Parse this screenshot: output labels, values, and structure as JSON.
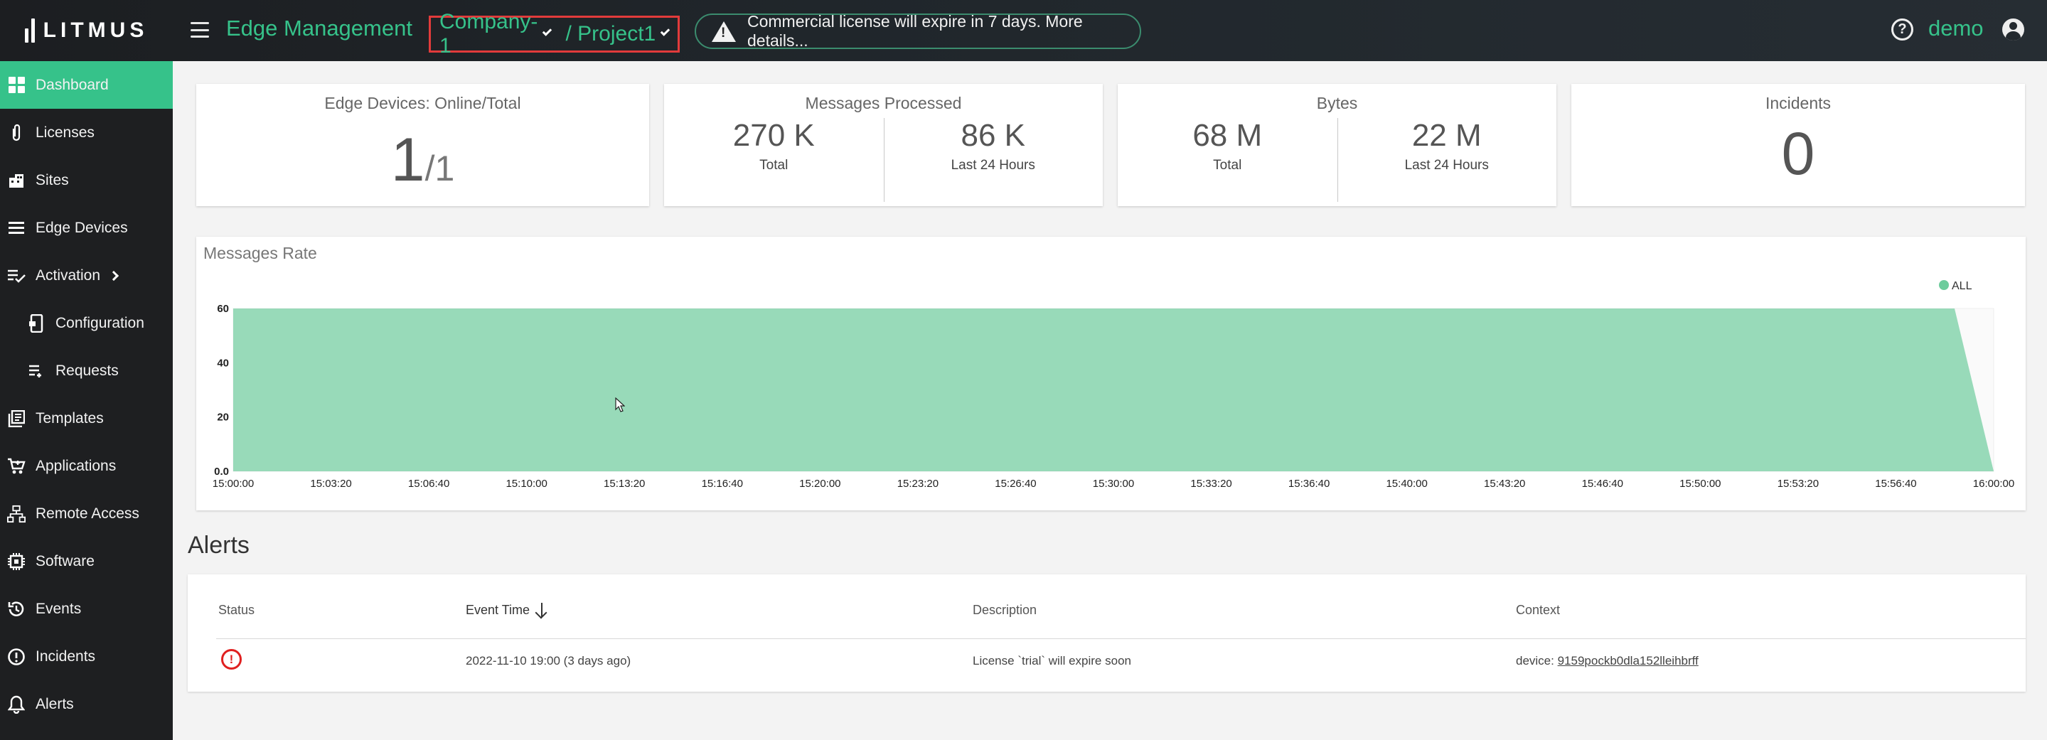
{
  "header": {
    "logo_text": "LITMUS",
    "app_title": "Edge Management",
    "company": "Company-1",
    "project_sep": " / ",
    "project": "Project1",
    "license_banner": "Commercial license will expire in 7 days. More details...",
    "user": "demo"
  },
  "sidebar": {
    "items": [
      {
        "label": "Dashboard",
        "icon": "dashboard-icon",
        "active": true
      },
      {
        "label": "Licenses",
        "icon": "paperclip-icon"
      },
      {
        "label": "Sites",
        "icon": "building-icon"
      },
      {
        "label": "Edge Devices",
        "icon": "list-icon"
      },
      {
        "label": "Activation",
        "icon": "checklist-icon"
      },
      {
        "label": "Configuration",
        "icon": "device-config-icon"
      },
      {
        "label": "Requests",
        "icon": "queue-icon"
      },
      {
        "label": "Templates",
        "icon": "templates-icon"
      },
      {
        "label": "Applications",
        "icon": "cart-icon"
      },
      {
        "label": "Remote Access",
        "icon": "network-icon"
      },
      {
        "label": "Software",
        "icon": "chip-icon"
      },
      {
        "label": "Events",
        "icon": "history-icon"
      },
      {
        "label": "Incidents",
        "icon": "alert-circle-icon"
      },
      {
        "label": "Alerts",
        "icon": "bell-icon"
      }
    ]
  },
  "stats": {
    "devices": {
      "title": "Edge Devices: Online/Total",
      "online": "1",
      "total": "/1"
    },
    "messages": {
      "title": "Messages Processed",
      "total": "270 K",
      "total_label": "Total",
      "last24": "86 K",
      "last24_label": "Last 24 Hours"
    },
    "bytes": {
      "title": "Bytes",
      "total": "68 M",
      "total_label": "Total",
      "last24": "22 M",
      "last24_label": "Last 24 Hours"
    },
    "incidents": {
      "title": "Incidents",
      "count": "0"
    }
  },
  "chart_data": {
    "type": "area",
    "title": "Messages Rate",
    "legend": [
      "ALL"
    ],
    "legend_position": "top-right",
    "color": "#6dcc9c",
    "y_ticks": [
      "0.0",
      "20",
      "40",
      "60"
    ],
    "ylim": [
      0,
      60
    ],
    "x_ticks": [
      "15:00:00",
      "15:03:20",
      "15:06:40",
      "15:10:00",
      "15:13:20",
      "15:16:40",
      "15:20:00",
      "15:23:20",
      "15:26:40",
      "15:30:00",
      "15:33:20",
      "15:36:40",
      "15:40:00",
      "15:43:20",
      "15:46:40",
      "15:50:00",
      "15:53:20",
      "15:56:40",
      "16:00:00"
    ],
    "series": [
      {
        "name": "ALL",
        "x": [
          "15:00:00",
          "15:58:40",
          "16:00:00"
        ],
        "y": [
          60,
          60,
          0
        ]
      }
    ]
  },
  "alerts": {
    "title": "Alerts",
    "columns": {
      "status": "Status",
      "event_time": "Event Time",
      "description": "Description",
      "context": "Context"
    },
    "rows": [
      {
        "status": "!",
        "event_time": "2022-11-10 19:00 (3 days ago)",
        "description": "License `trial` will expire soon",
        "context_prefix": "device: ",
        "context_link": "9159pockb0dla152lleihbrff"
      }
    ]
  }
}
